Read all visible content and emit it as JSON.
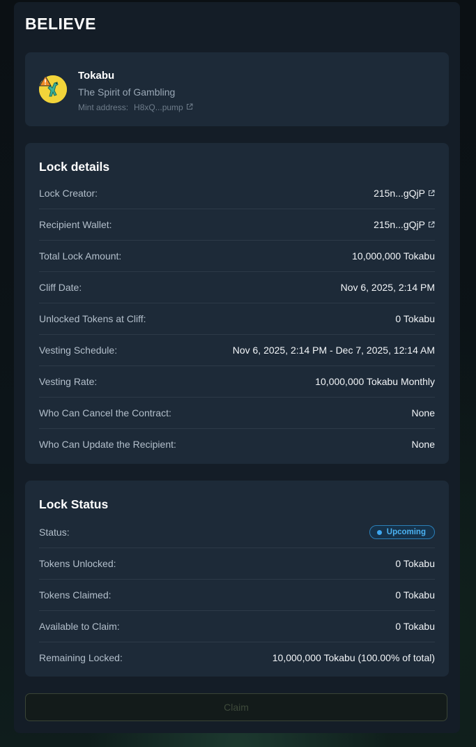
{
  "brand": "BELIEVE",
  "token": {
    "name": "Tokabu",
    "description": "The Spirit of Gambling",
    "mint_label": "Mint address:",
    "mint_address": "H8xQ...pump",
    "avatar_icon": "lizard-avatar",
    "warning_icon": "warning-triangle-icon"
  },
  "lock_details": {
    "title": "Lock details",
    "rows": [
      {
        "label": "Lock Creator:",
        "value": "215n...gQjP",
        "link": true
      },
      {
        "label": "Recipient Wallet:",
        "value": "215n...gQjP",
        "link": true
      },
      {
        "label": "Total Lock Amount:",
        "value": "10,000,000 Tokabu"
      },
      {
        "label": "Cliff Date:",
        "value": "Nov 6, 2025, 2:14 PM"
      },
      {
        "label": "Unlocked Tokens at Cliff:",
        "value": "0 Tokabu"
      },
      {
        "label": "Vesting Schedule:",
        "value": "Nov 6, 2025, 2:14 PM - Dec 7, 2025, 12:14 AM"
      },
      {
        "label": "Vesting Rate:",
        "value": "10,000,000 Tokabu Monthly"
      },
      {
        "label": "Who Can Cancel the Contract:",
        "value": "None"
      },
      {
        "label": "Who Can Update the Recipient:",
        "value": "None"
      }
    ]
  },
  "lock_status": {
    "title": "Lock Status",
    "status_label": "Status:",
    "status_badge": "Upcoming",
    "rows": [
      {
        "label": "Tokens Unlocked:",
        "value": "0 Tokabu"
      },
      {
        "label": "Tokens Claimed:",
        "value": "0 Tokabu"
      },
      {
        "label": "Available to Claim:",
        "value": "0 Tokabu"
      },
      {
        "label": "Remaining Locked:",
        "value": "10,000,000 Tokabu (100.00% of total)"
      }
    ]
  },
  "claim_button": "Claim",
  "colors": {
    "panel": "#141d27",
    "card": "#1d2a38",
    "badge_blue": "#4bb2f2",
    "avatar_yellow": "#f2d43a"
  }
}
